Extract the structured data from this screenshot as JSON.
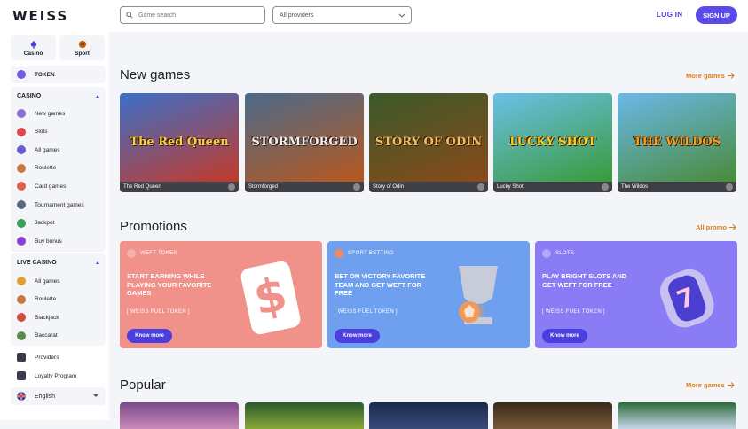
{
  "header": {
    "logo": "WEISS",
    "search_placeholder": "Game search",
    "providers_label": "All providers",
    "login_label": "LOG IN",
    "signup_label": "SIGN UP"
  },
  "sidebar": {
    "casino_tab": "Casino",
    "sport_tab": "Sport",
    "token_label": "TOKEN",
    "casino_section": "CASINO",
    "casino_items": [
      {
        "label": "New games",
        "icon": "crown-icon",
        "color": "#8b6fd6"
      },
      {
        "label": "Slots",
        "icon": "slots-icon",
        "color": "#e0464a"
      },
      {
        "label": "All games",
        "icon": "dice-icon",
        "color": "#6b5bd6"
      },
      {
        "label": "Roulette",
        "icon": "roulette-icon",
        "color": "#c9773a"
      },
      {
        "label": "Card games",
        "icon": "cards-icon",
        "color": "#e05a4a"
      },
      {
        "label": "Tournament games",
        "icon": "trophy-icon",
        "color": "#5a6a80"
      },
      {
        "label": "Jackpot",
        "icon": "jackpot-icon",
        "color": "#3aa05a"
      },
      {
        "label": "Buy bonus",
        "icon": "plus-icon",
        "color": "#8b3fd6"
      }
    ],
    "live_section": "LIVE CASINO",
    "live_items": [
      {
        "label": "All games",
        "icon": "flame-icon",
        "color": "#e0a030"
      },
      {
        "label": "Roulette",
        "icon": "roulette-icon",
        "color": "#c9773a"
      },
      {
        "label": "Blackjack",
        "icon": "blackjack-icon",
        "color": "#d04a3a"
      },
      {
        "label": "Baccarat",
        "icon": "baccarat-icon",
        "color": "#5a8a4a"
      }
    ],
    "providers": "Providers",
    "loyalty": "Loyalty Program",
    "language": "English"
  },
  "new_games": {
    "title": "New games",
    "more": "More games",
    "items": [
      {
        "name": "The Red Queen",
        "art_text": "The Red Queen",
        "bg1": "#3a6fc8",
        "bg2": "#c43a2a",
        "txt": "#f8d048"
      },
      {
        "name": "Stormforged",
        "art_text": "STORMFORGED",
        "bg1": "#4a6a8a",
        "bg2": "#b8581e",
        "txt": "#e8eef4"
      },
      {
        "name": "Story of Odin",
        "art_text": "STORY OF ODIN",
        "bg1": "#3a5a2a",
        "bg2": "#8a4a1a",
        "txt": "#f0c060"
      },
      {
        "name": "Lucky Shot",
        "art_text": "LUCKY SHOT",
        "bg1": "#6ac0e8",
        "bg2": "#3a9a3a",
        "txt": "#f8d020"
      },
      {
        "name": "The Wildos",
        "art_text": "THE WILDOS",
        "bg1": "#6ab8e8",
        "bg2": "#4a8a3a",
        "txt": "#f0a020"
      }
    ]
  },
  "promotions": {
    "title": "Promotions",
    "more": "All promo",
    "items": [
      {
        "tag": "WEFT TOKEN",
        "headline": "START EARNING WHILE PLAYING YOUR FAVORITE GAMES",
        "sub": "[ WEISS FUEL TOKEN ]",
        "button": "Know more",
        "bg": "#f0918a"
      },
      {
        "tag": "SPORT BETTING",
        "headline": "BET ON VICTORY FAVORITE TEAM AND GET WEFT FOR FREE",
        "sub": "[ WEISS FUEL TOKEN ]",
        "button": "Know more",
        "bg": "#6fa0f0"
      },
      {
        "tag": "SLOTS",
        "headline": "PLAY BRIGHT SLOTS AND GET WEFT FOR FREE",
        "sub": "[ WEISS FUEL TOKEN ]",
        "button": "Know more",
        "bg": "#8a7cf4"
      }
    ]
  },
  "popular": {
    "title": "Popular",
    "more": "More games"
  }
}
